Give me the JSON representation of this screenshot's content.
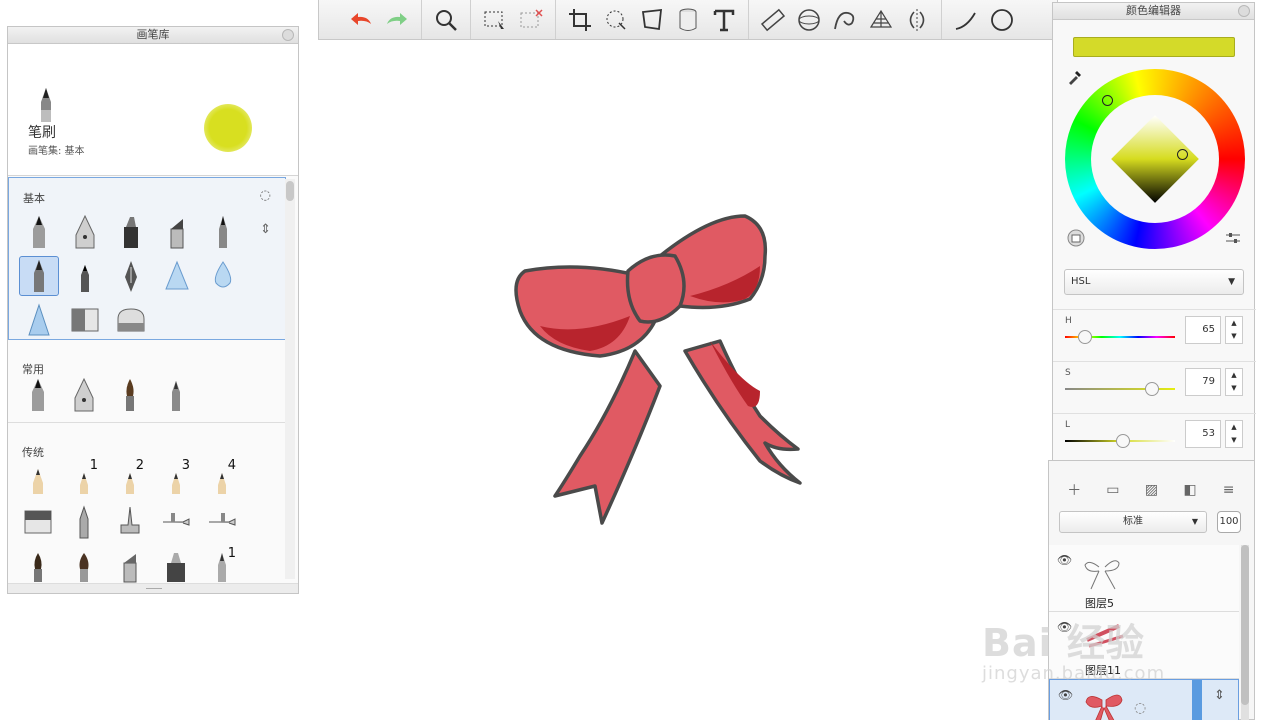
{
  "brush_library": {
    "title": "画笔库",
    "current_brush": {
      "name": "笔刷",
      "set_label": "画笔集: 基本"
    },
    "sections": [
      {
        "label": "基本"
      },
      {
        "label": "常用"
      },
      {
        "label": "传统"
      }
    ],
    "traditional_numbers": [
      "1",
      "2",
      "3",
      "4",
      "1"
    ]
  },
  "color_editor": {
    "title": "颜色编辑器",
    "current_color": "#d4da29",
    "mode": "HSL",
    "sliders": [
      {
        "label": "H",
        "value": "65",
        "fraction": 0.18
      },
      {
        "label": "S",
        "value": "79",
        "fraction": 0.79
      },
      {
        "label": "L",
        "value": "53",
        "fraction": 0.53
      }
    ]
  },
  "layers": {
    "blend_mode": "标准",
    "opacity": "100",
    "items": [
      {
        "name": "图层5"
      },
      {
        "name": "图层11"
      },
      {
        "name": ""
      }
    ]
  },
  "watermark": {
    "main": "Bai 经验",
    "sub": "jingyan.baidu.com"
  }
}
